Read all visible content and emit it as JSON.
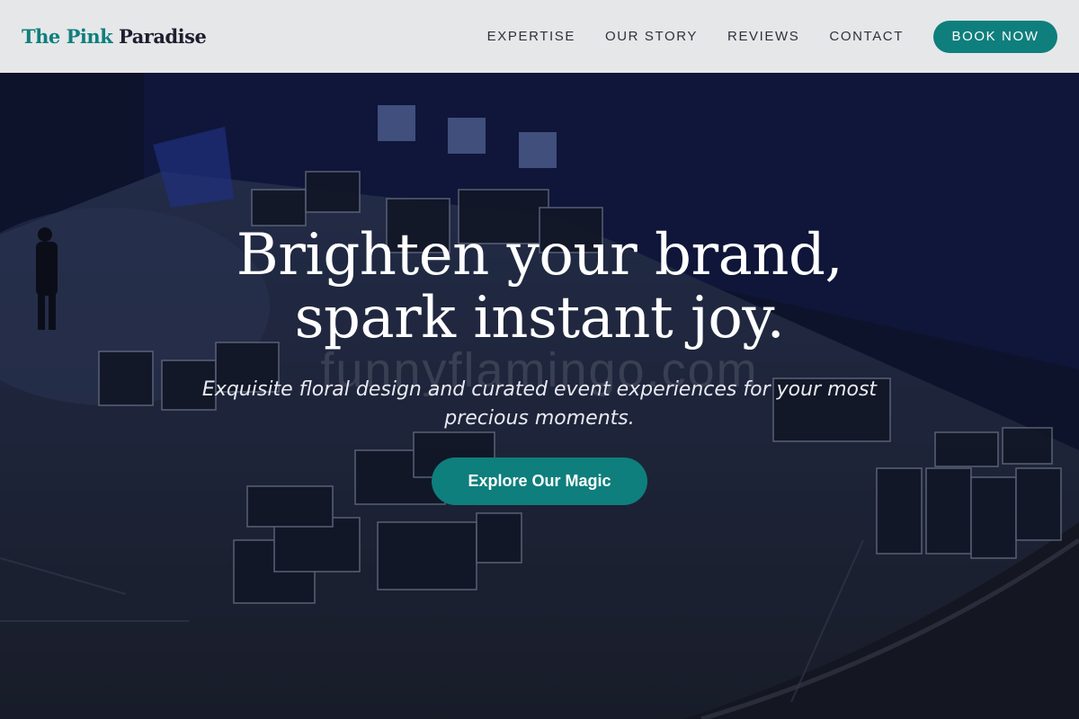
{
  "header": {
    "logo": {
      "part1": "The Pink",
      "part2": "Paradise"
    },
    "nav": [
      {
        "label": "EXPERTISE"
      },
      {
        "label": "OUR STORY"
      },
      {
        "label": "REVIEWS"
      },
      {
        "label": "CONTACT"
      }
    ],
    "book_label": "BOOK NOW"
  },
  "hero": {
    "title_line1": "Brighten your brand,",
    "title_line2": "spark instant joy.",
    "watermark": "funnyflamingo.com",
    "subtitle": "Exquisite floral design and curated event experiences for your most precious moments.",
    "cta_label": "Explore Our Magic",
    "background_image": "dim arena floor with stacked road cases and equipment"
  },
  "colors": {
    "accent": "#0e7f7c",
    "header_bg": "#e6e7e9",
    "logo_dark": "#1b1f2e",
    "hero_overlay": "#0c1022"
  }
}
